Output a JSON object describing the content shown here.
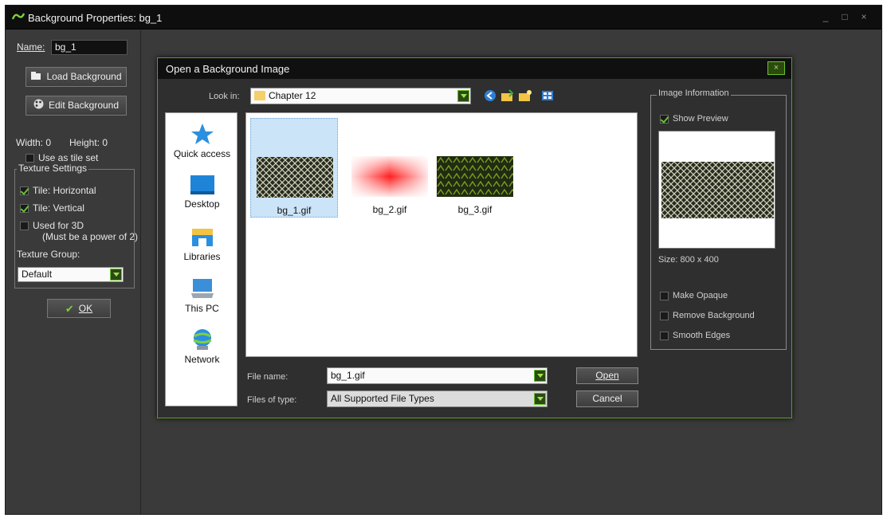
{
  "window": {
    "title": "Background Properties: bg_1",
    "controls": [
      "_",
      "□",
      "×"
    ]
  },
  "left_panel": {
    "name_label": "Name:",
    "name_value": "bg_1",
    "load_button": "Load Background",
    "edit_button": "Edit Background",
    "width_label": "Width: 0",
    "height_label": "Height: 0",
    "use_as_tile_set": "Use as tile set",
    "texture_settings": {
      "legend": "Texture Settings",
      "tile_horizontal": "Tile: Horizontal",
      "tile_vertical": "Tile: Vertical",
      "used_for_3d": "Used for 3D",
      "power_of_2": "(Must be a power of 2)",
      "group_label": "Texture Group:",
      "group_value": "Default"
    },
    "ok_button": "OK"
  },
  "dialog": {
    "title": "Open a Background Image",
    "close": "×",
    "look_in_label": "Look in:",
    "look_in_value": "Chapter 12",
    "toolbar_icons": [
      "back-icon",
      "up-folder-icon",
      "new-folder-icon",
      "view-menu-icon"
    ],
    "places": [
      {
        "label": "Quick access",
        "icon": "star-icon"
      },
      {
        "label": "Desktop",
        "icon": "desktop-icon"
      },
      {
        "label": "Libraries",
        "icon": "libraries-icon"
      },
      {
        "label": "This PC",
        "icon": "computer-icon"
      },
      {
        "label": "Network",
        "icon": "network-icon"
      }
    ],
    "files": [
      {
        "name": "bg_1.gif",
        "selected": true
      },
      {
        "name": "bg_2.gif",
        "selected": false
      },
      {
        "name": "bg_3.gif",
        "selected": false
      }
    ],
    "file_name_label": "File name:",
    "file_name_value": "bg_1.gif",
    "file_type_label": "Files of type:",
    "file_type_value": "All Supported File Types",
    "open_button": "Open",
    "cancel_button": "Cancel",
    "image_info": {
      "legend": "Image Information",
      "show_preview": "Show Preview",
      "size_text": "Size: 800 x 400",
      "make_opaque": "Make Opaque",
      "remove_background": "Remove Background",
      "smooth_edges": "Smooth Edges"
    }
  },
  "colors": {
    "accent_green": "#69c22f",
    "window_bg": "#3a3a3a",
    "dialog_bg": "#2f2f2f"
  }
}
